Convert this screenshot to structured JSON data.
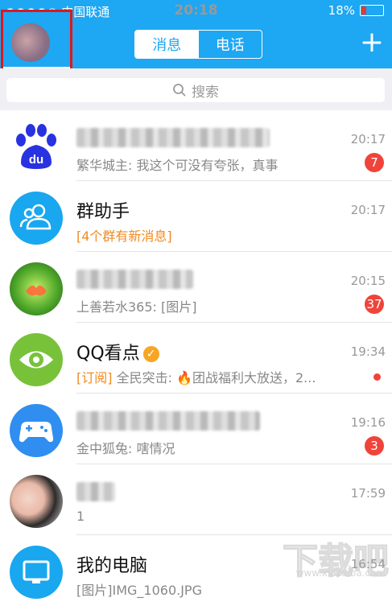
{
  "status_bar": {
    "carrier": "●●●●○ 中国联通",
    "time": "20:18",
    "battery": "18%"
  },
  "header": {
    "tabs": [
      {
        "label": "消息",
        "active": true
      },
      {
        "label": "电话",
        "active": false
      }
    ],
    "add_symbol": "+"
  },
  "search": {
    "placeholder": "搜索"
  },
  "conversations": [
    {
      "name": "",
      "preview": "繁华城主: 我这个可没有夸张，真事",
      "time": "20:17",
      "badge": "7",
      "icon": "baidu-icon"
    },
    {
      "name": "群助手",
      "preview": "[4个群有新消息]",
      "time": "20:17",
      "badge": "",
      "icon": "group-assistant-icon"
    },
    {
      "name": "",
      "preview": "上善若水365: [图片]",
      "time": "20:15",
      "badge": "37",
      "icon": "group-avatar"
    },
    {
      "name": "QQ看点",
      "preview_tag": "[订阅]",
      "preview": " 全民突击: 🔥团战福利大放送，2...",
      "time": "19:34",
      "badge": "",
      "icon": "eye-icon"
    },
    {
      "name": "",
      "preview": "金中狐兔: 嗐情况",
      "time": "19:16",
      "badge": "3",
      "icon": "gamepad-icon"
    },
    {
      "name": "",
      "preview": "1",
      "time": "17:59",
      "badge": "",
      "icon": "user-photo-avatar"
    },
    {
      "name": "我的电脑",
      "preview": "[图片]IMG_1060.JPG",
      "time": "16:54",
      "badge": "",
      "icon": "computer-icon"
    }
  ],
  "watermark": {
    "text": "下载吧",
    "url": "www.xiazaiba.com"
  },
  "colors": {
    "brand": "#1ea7f2",
    "badge": "#f0433a",
    "orange": "#f08a1f"
  }
}
